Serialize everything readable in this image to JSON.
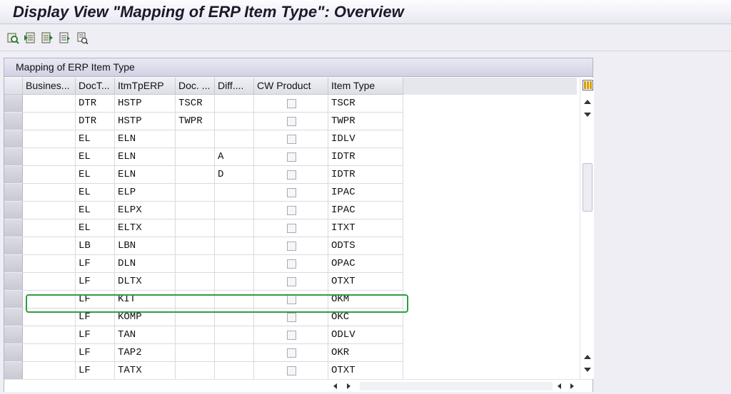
{
  "window": {
    "title": "Display View \"Mapping of ERP Item Type\": Overview"
  },
  "toolbar": {
    "buttons": [
      {
        "icon": "details-icon"
      },
      {
        "icon": "previous-entry-icon"
      },
      {
        "icon": "next-entry-icon"
      },
      {
        "icon": "variable-list-icon"
      },
      {
        "icon": "print-icon"
      }
    ]
  },
  "table": {
    "title": "Mapping of ERP Item Type",
    "columns": [
      "Busines...",
      "DocT...",
      "ItmTpERP",
      "Doc. ...",
      "Diff....",
      "CW Product",
      "Item Type"
    ],
    "rows": [
      {
        "business": "",
        "doctype": "DTR",
        "itmtp": "HSTP",
        "doc": "TSCR",
        "diff": "",
        "cw": false,
        "item_type": "TSCR"
      },
      {
        "business": "",
        "doctype": "DTR",
        "itmtp": "HSTP",
        "doc": "TWPR",
        "diff": "",
        "cw": false,
        "item_type": "TWPR"
      },
      {
        "business": "",
        "doctype": "EL",
        "itmtp": "ELN",
        "doc": "",
        "diff": "",
        "cw": false,
        "item_type": "IDLV"
      },
      {
        "business": "",
        "doctype": "EL",
        "itmtp": "ELN",
        "doc": "",
        "diff": "A",
        "cw": false,
        "item_type": "IDTR"
      },
      {
        "business": "",
        "doctype": "EL",
        "itmtp": "ELN",
        "doc": "",
        "diff": "D",
        "cw": false,
        "item_type": "IDTR"
      },
      {
        "business": "",
        "doctype": "EL",
        "itmtp": "ELP",
        "doc": "",
        "diff": "",
        "cw": false,
        "item_type": "IPAC"
      },
      {
        "business": "",
        "doctype": "EL",
        "itmtp": "ELPX",
        "doc": "",
        "diff": "",
        "cw": false,
        "item_type": "IPAC"
      },
      {
        "business": "",
        "doctype": "EL",
        "itmtp": "ELTX",
        "doc": "",
        "diff": "",
        "cw": false,
        "item_type": "ITXT"
      },
      {
        "business": "",
        "doctype": "LB",
        "itmtp": "LBN",
        "doc": "",
        "diff": "",
        "cw": false,
        "item_type": "ODTS"
      },
      {
        "business": "",
        "doctype": "LF",
        "itmtp": "DLN",
        "doc": "",
        "diff": "",
        "cw": false,
        "item_type": "OPAC"
      },
      {
        "business": "",
        "doctype": "LF",
        "itmtp": "DLTX",
        "doc": "",
        "diff": "",
        "cw": false,
        "item_type": "OTXT"
      },
      {
        "business": "",
        "doctype": "LF",
        "itmtp": "KIT",
        "doc": "",
        "diff": "",
        "cw": false,
        "item_type": "OKM"
      },
      {
        "business": "",
        "doctype": "LF",
        "itmtp": "KOMP",
        "doc": "",
        "diff": "",
        "cw": false,
        "item_type": "OKC"
      },
      {
        "business": "",
        "doctype": "LF",
        "itmtp": "TAN",
        "doc": "",
        "diff": "",
        "cw": false,
        "item_type": "ODLV"
      },
      {
        "business": "",
        "doctype": "LF",
        "itmtp": "TAP2",
        "doc": "",
        "diff": "",
        "cw": false,
        "item_type": "OKR"
      },
      {
        "business": "",
        "doctype": "LF",
        "itmtp": "TATX",
        "doc": "",
        "diff": "",
        "cw": false,
        "item_type": "OTXT"
      }
    ]
  },
  "colors": {
    "highlight": "#2e9e3e",
    "title_bg": "#e8e8f2",
    "panel_head": "#d1d1e4"
  }
}
